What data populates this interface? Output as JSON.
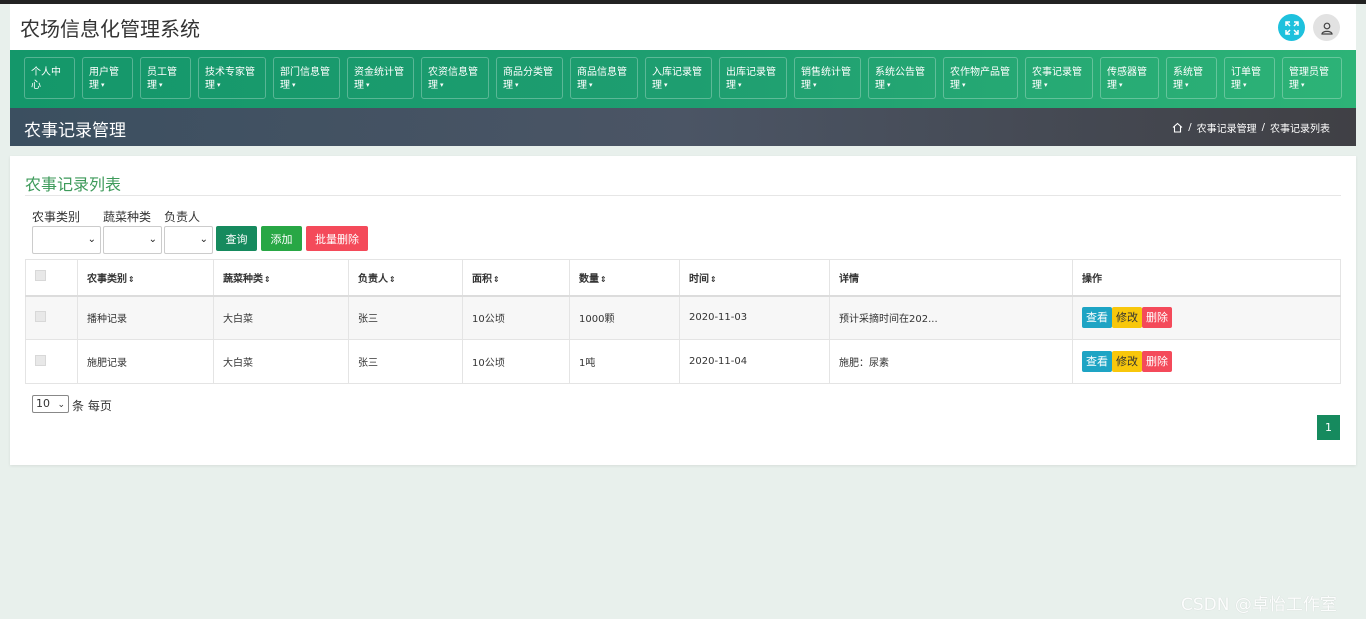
{
  "header": {
    "title": "农场信息化管理系统"
  },
  "nav": {
    "items": [
      {
        "label": "个人中心"
      },
      {
        "label": "用户管理"
      },
      {
        "label": "员工管理"
      },
      {
        "label": "技术专家管理"
      },
      {
        "label": "部门信息管理"
      },
      {
        "label": "资金统计管理"
      },
      {
        "label": "农资信息管理"
      },
      {
        "label": "商品分类管理"
      },
      {
        "label": "商品信息管理"
      },
      {
        "label": "入库记录管理"
      },
      {
        "label": "出库记录管理"
      },
      {
        "label": "销售统计管理"
      },
      {
        "label": "系统公告管理"
      },
      {
        "label": "农作物产品管理"
      },
      {
        "label": "农事记录管理"
      },
      {
        "label": "传感器管理"
      },
      {
        "label": "系统管理"
      },
      {
        "label": "订单管理"
      },
      {
        "label": "管理员管理"
      }
    ]
  },
  "pagebar": {
    "title": "农事记录管理",
    "breadcrumb": [
      "农事记录管理",
      "农事记录列表"
    ],
    "separator": "/"
  },
  "card": {
    "title": "农事记录列表"
  },
  "filters": {
    "labels": [
      "农事类别",
      "蔬菜种类",
      "负责人"
    ],
    "query_label": "查询",
    "add_label": "添加",
    "batch_delete_label": "批量删除"
  },
  "table": {
    "headers": [
      "农事类别",
      "蔬菜种类",
      "负责人",
      "面积",
      "数量",
      "时间",
      "详情",
      "操作"
    ],
    "rows": [
      [
        "播种记录",
        "大白菜",
        "张三",
        "10公顷",
        "1000颗",
        "2020-11-03",
        "预计采摘时间在202..."
      ],
      [
        "施肥记录",
        "大白菜",
        "张三",
        "10公顷",
        "1吨",
        "2020-11-04",
        "施肥：尿素"
      ]
    ],
    "actions": {
      "view": "查看",
      "edit": "修改",
      "delete": "删除"
    }
  },
  "pagination": {
    "page_size": "10",
    "page_size_label": "条 每页",
    "current_page": "1"
  },
  "watermark": "CSDN @卓怡工作室",
  "colors": {
    "nav": "#1e9e70",
    "primary": "#168a5e",
    "danger": "#f44a5a",
    "warning": "#f8c70b",
    "info": "#1ea4c4",
    "title_green": "#3d9a5a"
  }
}
